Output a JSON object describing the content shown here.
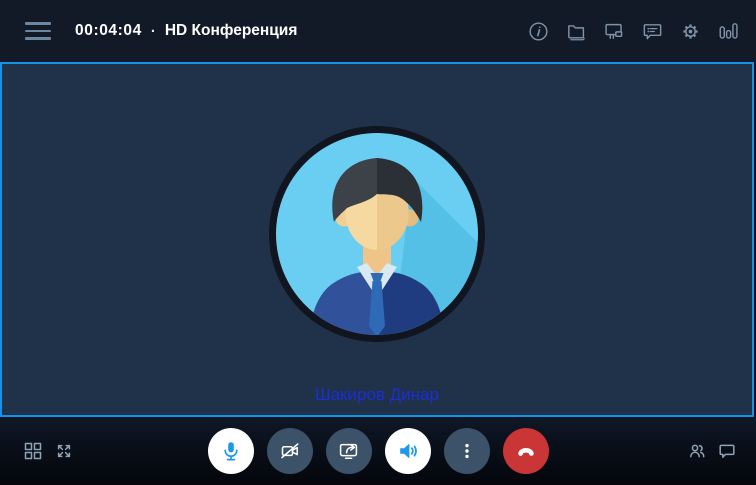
{
  "header": {
    "timer": "00:04:04",
    "separator": "·",
    "title": "HD Конференция",
    "menu_icon": "hamburger-icon",
    "icons": [
      {
        "name": "info-icon"
      },
      {
        "name": "files-folder-icon"
      },
      {
        "name": "whiteboard-icon"
      },
      {
        "name": "chat-messages-icon"
      },
      {
        "name": "settings-gear-icon"
      },
      {
        "name": "stats-bars-icon"
      }
    ]
  },
  "participant": {
    "name": "Шакиров Динар",
    "avatar": "flat-man-in-suit-illustration"
  },
  "footer": {
    "left_icons": [
      "layout-grid-icon",
      "fullscreen-expand-icon"
    ],
    "buttons": [
      {
        "name": "microphone-button",
        "state": "active"
      },
      {
        "name": "camera-button",
        "state": "off"
      },
      {
        "name": "screen-share-button",
        "state": "idle"
      },
      {
        "name": "speaker-button",
        "state": "active"
      },
      {
        "name": "more-options-button",
        "state": "idle"
      },
      {
        "name": "hangup-button",
        "state": "danger"
      }
    ],
    "right_icons": [
      "participants-icon",
      "chat-bubble-icon"
    ]
  },
  "colors": {
    "accent_border_blue": "#1591e8",
    "active_icon_blue": "#1e98e8",
    "hangup_red": "#ca3535",
    "participant_name_blue": "#1c2fd2",
    "topbar_bg": "#121a28",
    "tile_bg": "#20314a",
    "inactive_button": "#3c5269"
  }
}
